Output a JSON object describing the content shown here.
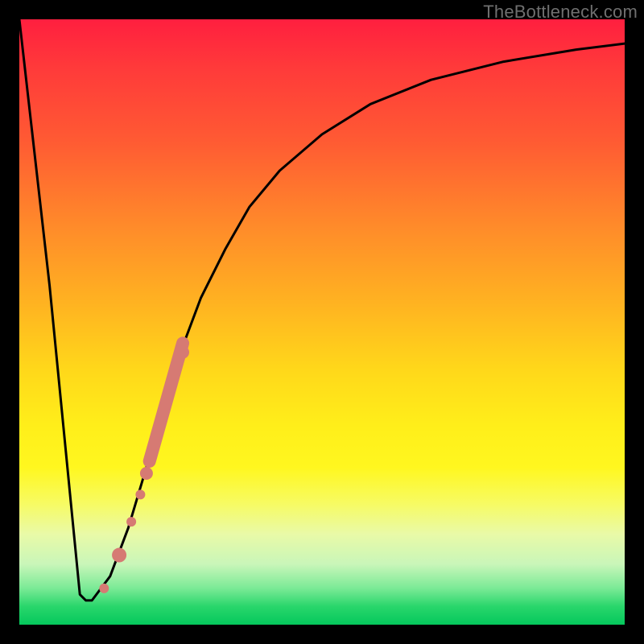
{
  "watermark": "TheBottleneck.com",
  "chart_data": {
    "type": "line",
    "title": "",
    "xlabel": "",
    "ylabel": "",
    "xlim": [
      0,
      100
    ],
    "ylim": [
      0,
      100
    ],
    "background_meaning": "vertical gradient: top=red (bad), bottom=green (good)",
    "series": [
      {
        "name": "bottleneck-curve",
        "stroke": "#000000",
        "x": [
          0,
          5,
          10,
          11,
          12,
          15,
          18,
          21,
          24,
          27,
          30,
          34,
          38,
          43,
          50,
          58,
          68,
          80,
          92,
          100
        ],
        "values": [
          100,
          56,
          5,
          4,
          4,
          8,
          16,
          26,
          36,
          46,
          54,
          62,
          69,
          75,
          81,
          86,
          90,
          93,
          95,
          96
        ]
      }
    ],
    "highlight_segment": {
      "name": "highlight-band",
      "color": "#d67a73",
      "points": [
        {
          "x": 14.0,
          "y": 6.0,
          "r": 6
        },
        {
          "x": 16.5,
          "y": 11.5,
          "r": 9
        },
        {
          "x": 18.5,
          "y": 17.0,
          "r": 6
        },
        {
          "x": 20.0,
          "y": 21.5,
          "r": 6
        },
        {
          "x": 21.0,
          "y": 25.0,
          "r": 8
        },
        {
          "x": 27.0,
          "y": 45.0,
          "r": 8
        }
      ],
      "thick_start": {
        "x": 21.5,
        "y": 27.0
      },
      "thick_end": {
        "x": 27.0,
        "y": 46.5
      }
    }
  }
}
